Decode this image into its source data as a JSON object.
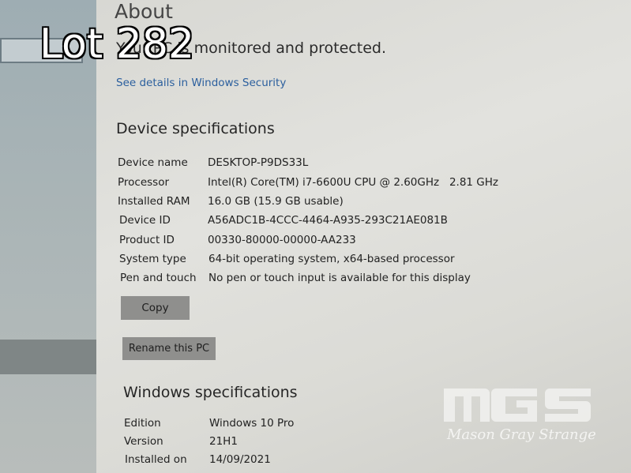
{
  "overlay": {
    "lot_label": "Lot 282"
  },
  "about": {
    "title": "About",
    "protection_text": "Your PC is monitored and protected.",
    "security_link": "See details in Windows Security"
  },
  "device_specs": {
    "heading": "Device specifications",
    "rows": [
      {
        "label": "Device name",
        "value": "DESKTOP-P9DS33L"
      },
      {
        "label": "Processor",
        "value": "Intel(R) Core(TM) i7-6600U CPU @ 2.60GHz   2.81 GHz"
      },
      {
        "label": "Installed RAM",
        "value": "16.0 GB (15.9 GB usable)"
      },
      {
        "label": "Device ID",
        "value": "A56ADC1B-4CCC-4464-A935-293C21AE081B"
      },
      {
        "label": "Product ID",
        "value": "00330-80000-00000-AA233"
      },
      {
        "label": "System type",
        "value": "64-bit operating system, x64-based processor"
      },
      {
        "label": "Pen and touch",
        "value": "No pen or touch input is available for this display"
      }
    ],
    "copy_button": "Copy",
    "rename_button": "Rename this PC"
  },
  "windows_specs": {
    "heading": "Windows specifications",
    "rows": [
      {
        "label": "Edition",
        "value": "Windows 10 Pro"
      },
      {
        "label": "Version",
        "value": "21H1"
      },
      {
        "label": "Installed on",
        "value": "14/09/2021"
      }
    ]
  },
  "watermark": {
    "logo_text": "MGS",
    "caption": "Mason Gray Strange"
  }
}
